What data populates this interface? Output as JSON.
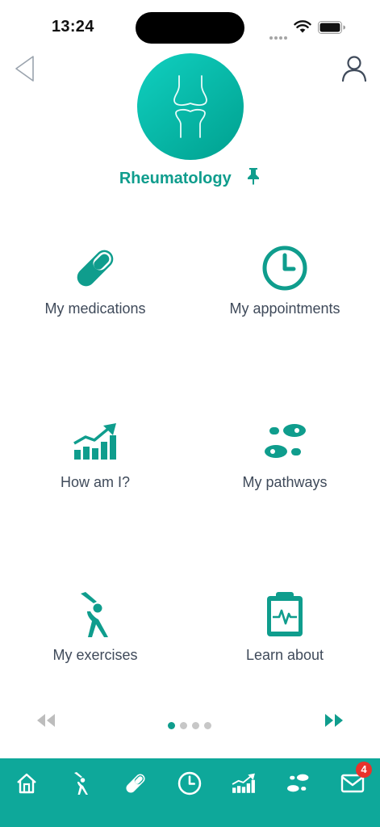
{
  "status_bar": {
    "time": "13:24"
  },
  "header": {
    "specialty_title": "Rheumatology"
  },
  "tiles": [
    {
      "label": "My medications",
      "icon": "pill-icon"
    },
    {
      "label": "My appointments",
      "icon": "clock-icon"
    },
    {
      "label": "How am I?",
      "icon": "chart-trend-icon"
    },
    {
      "label": "My pathways",
      "icon": "footprints-icon"
    },
    {
      "label": "My exercises",
      "icon": "stretching-person-icon"
    },
    {
      "label": "Learn about",
      "icon": "clipboard-heartbeat-icon"
    }
  ],
  "pager": {
    "page_count": 4,
    "current_page": 1
  },
  "bottom_nav": {
    "items": [
      "home-icon",
      "exercise-icon",
      "pill-icon",
      "clock-icon",
      "chart-icon",
      "footprints-icon",
      "mail-icon"
    ],
    "mail_badge": "4"
  },
  "colors": {
    "accent": "#0f9d8d",
    "nav_background": "#0ea89a",
    "badge": "#e8322c"
  }
}
